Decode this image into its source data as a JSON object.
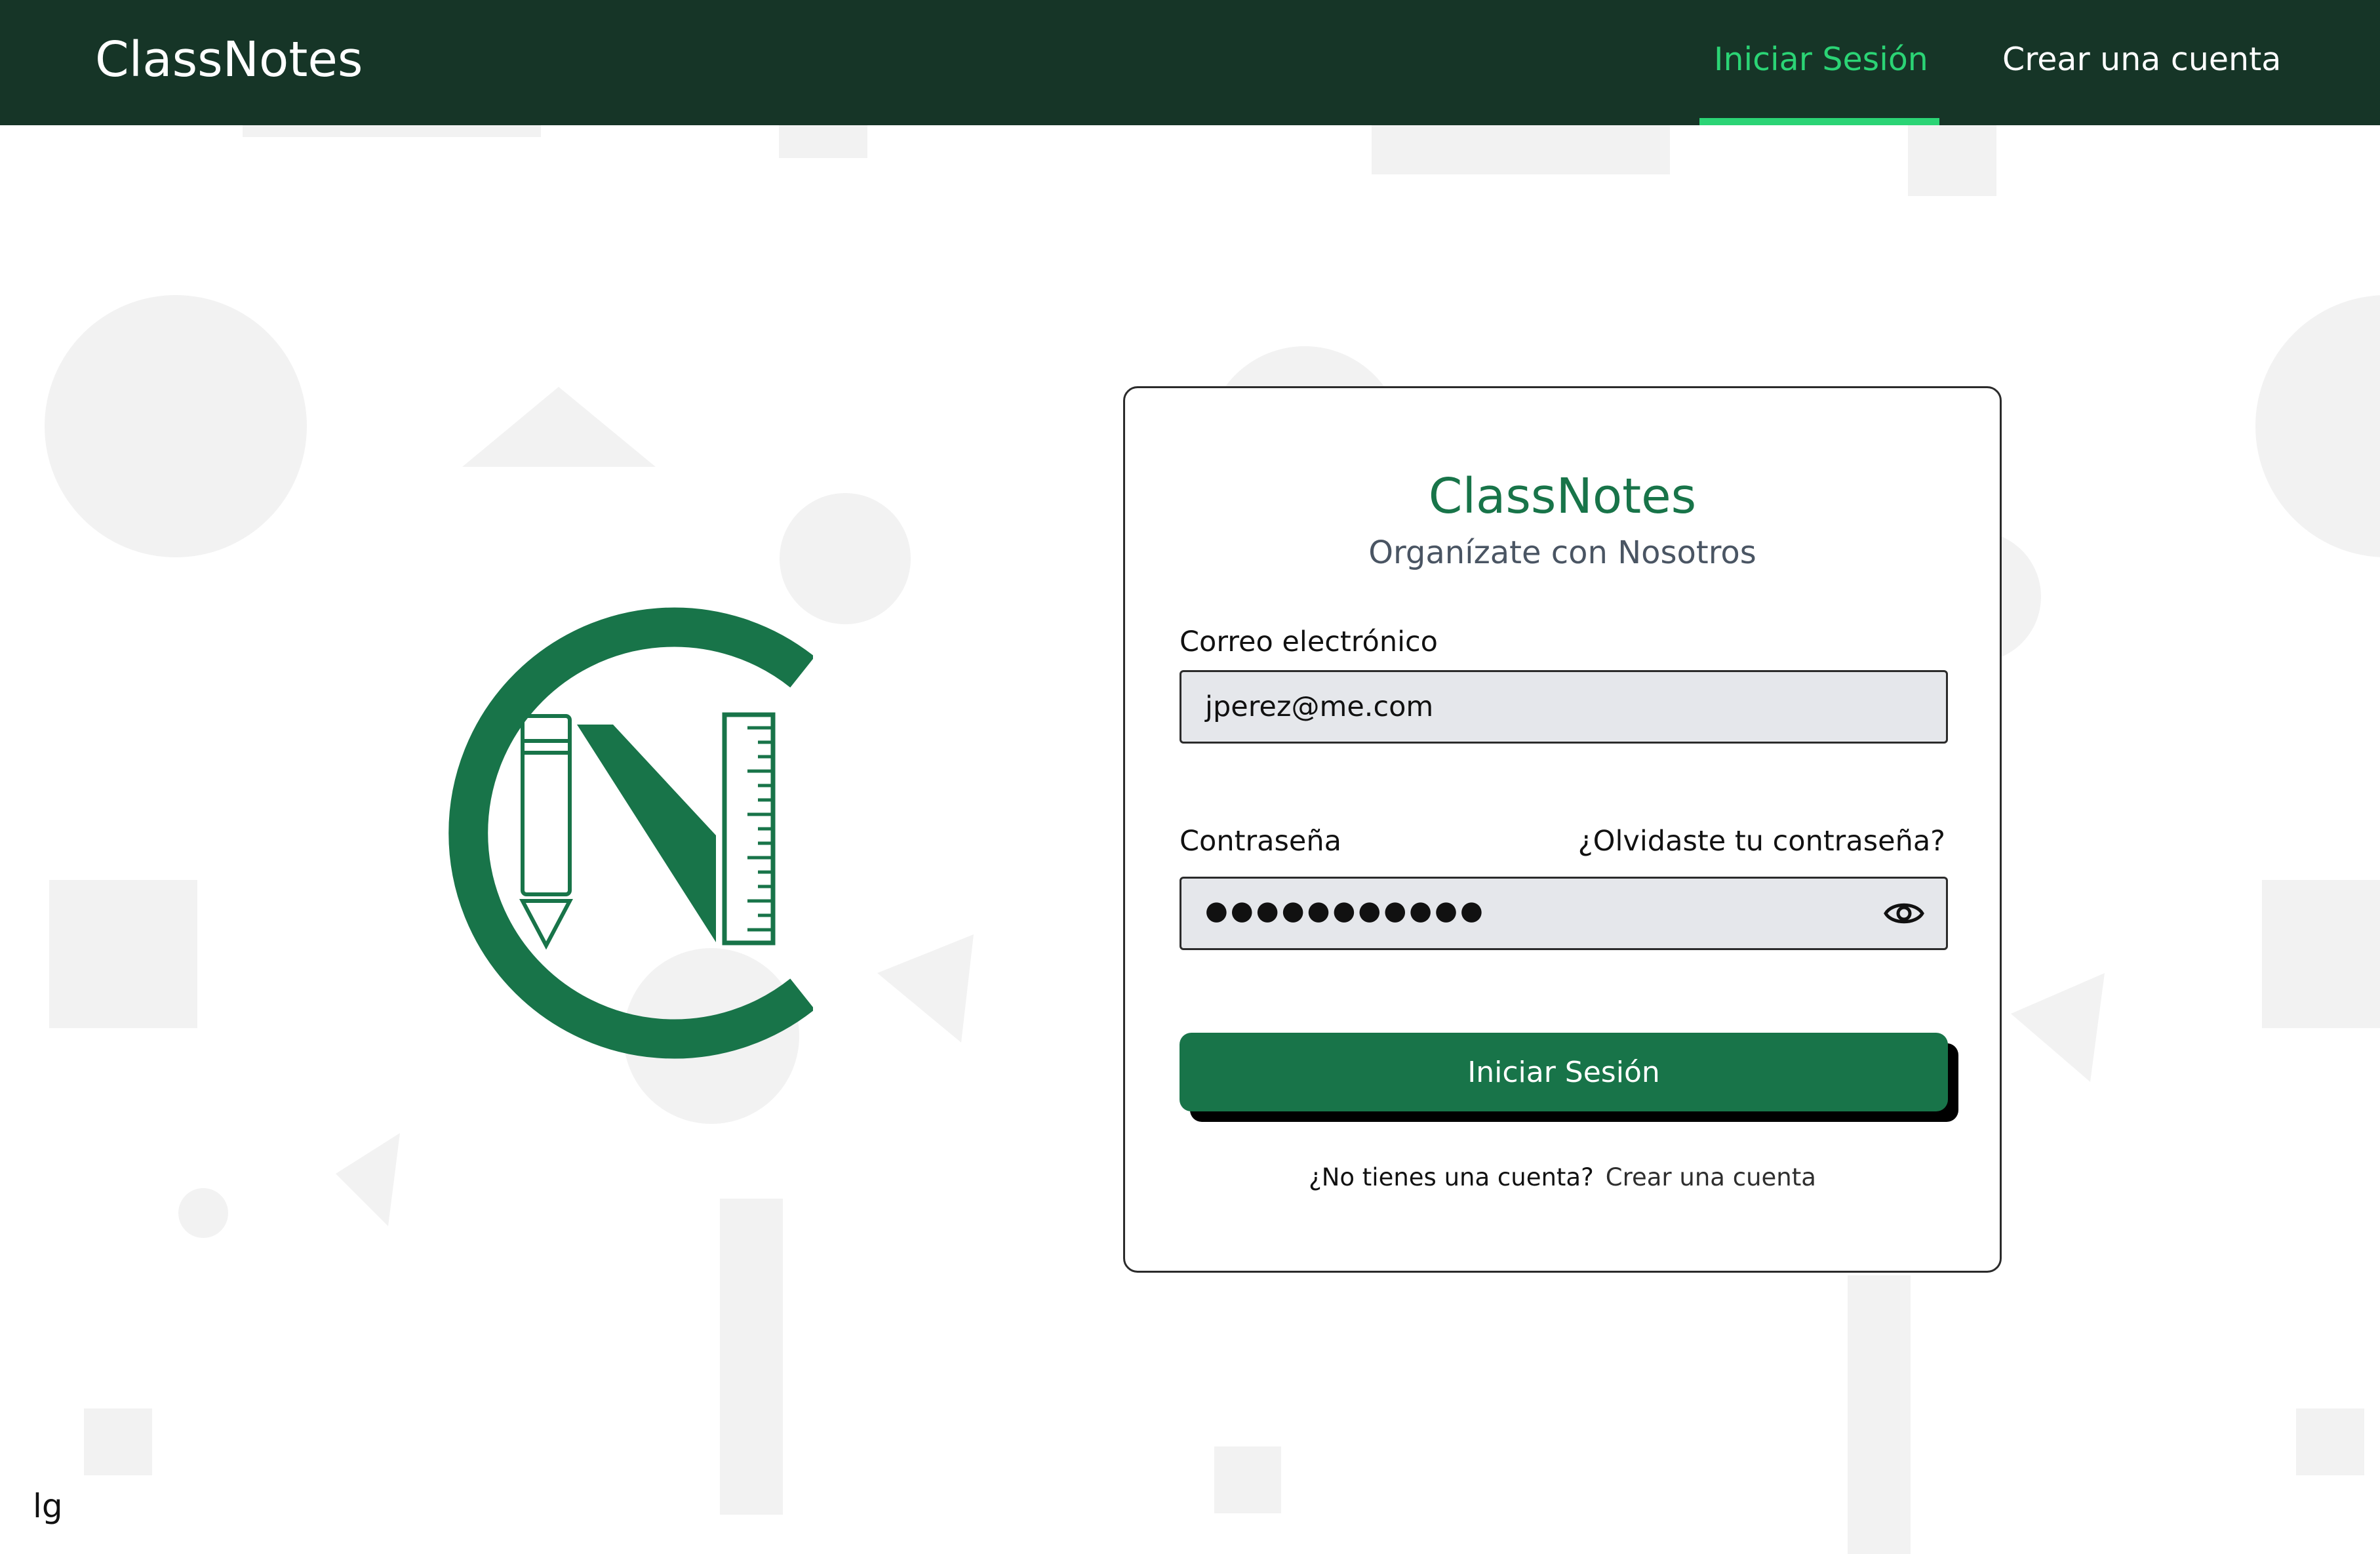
{
  "nav": {
    "brand": "ClassNotes",
    "login_label": "Iniciar Sesión",
    "signup_label": "Crear una cuenta"
  },
  "login_card": {
    "title": "ClassNotes",
    "subtitle": "Organízate con Nosotros",
    "email_label": "Correo electrónico",
    "email_value": "jperez@me.com",
    "password_label": "Contraseña",
    "forgot_label": "¿Olvidaste tu contraseña?",
    "password_mask": "●●●●●●●●●●●",
    "submit_label": "Iniciar Sesión",
    "no_account_text": "¿No tienes una cuenta?",
    "signup_link": "Crear una cuenta"
  },
  "breakpoint_badge": "lg",
  "icons": [
    "eye-icon",
    "classnotes-logo"
  ],
  "colors": {
    "navbar_bg": "#163527",
    "nav_active": "#2bd475",
    "brand_green": "#187449",
    "input_bg": "#e5e7eb",
    "bg_shapes": "#f2f2f2"
  }
}
